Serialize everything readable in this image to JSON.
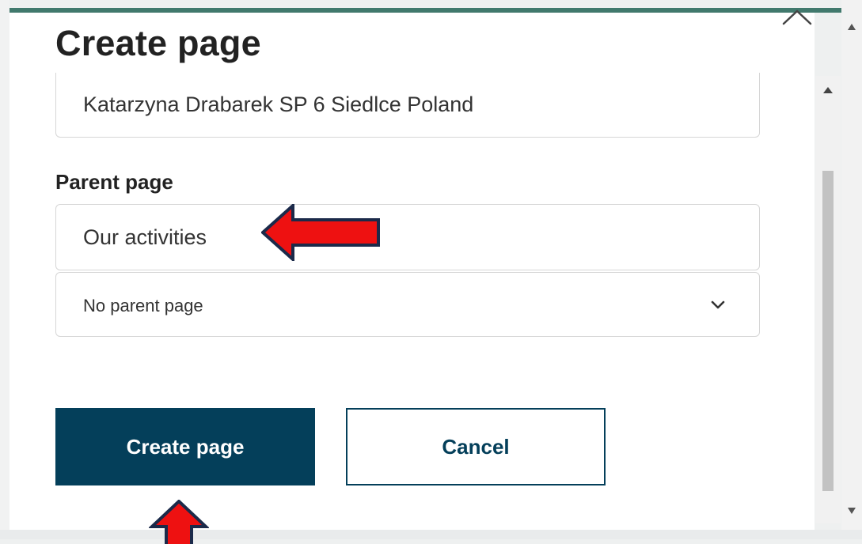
{
  "dialog": {
    "title": "Create page",
    "title_field_value": "Katarzyna Drabarek SP 6 Siedlce Poland",
    "parent_label": "Parent page",
    "parent_input_value": "Our activities",
    "parent_select_value": "No parent page",
    "create_button_label": "Create page",
    "cancel_button_label": "Cancel"
  },
  "icons": {
    "close": "close-icon",
    "chevron": "chevron-down-icon",
    "annotation_arrow": "red-arrow-icon"
  },
  "colors": {
    "accent_bar": "#41796d",
    "primary_button": "#043f5a",
    "annotation_arrow": "#ff0000"
  }
}
